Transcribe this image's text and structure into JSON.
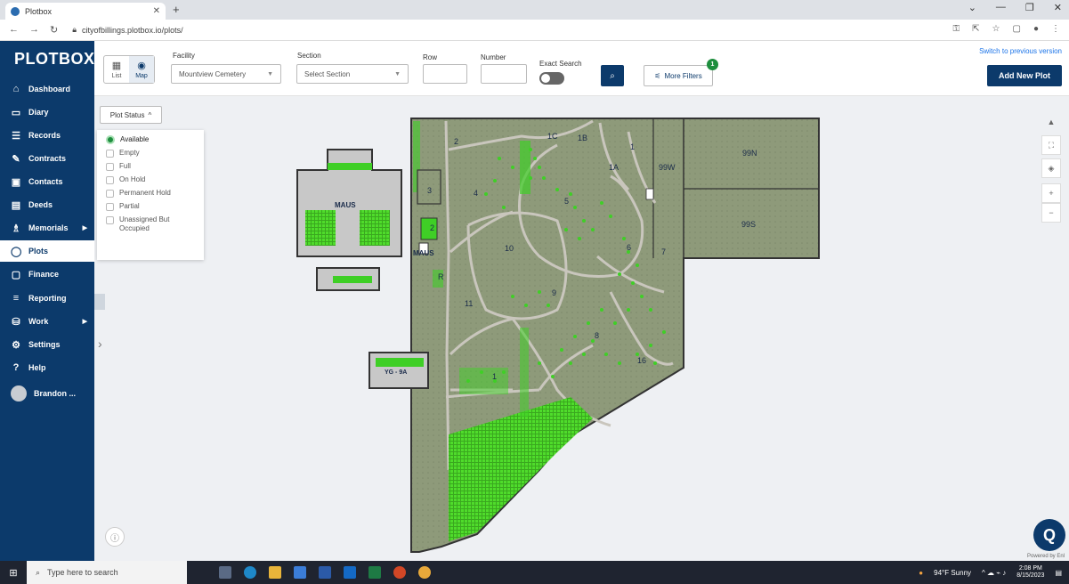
{
  "browser": {
    "tab_title": "Plotbox",
    "url": "cityofbillings.plotbox.io/plots/"
  },
  "sidebar": {
    "logo": "PLOTBOX",
    "items": [
      {
        "label": "Dashboard",
        "icon": "home-icon"
      },
      {
        "label": "Diary",
        "icon": "calendar-icon"
      },
      {
        "label": "Records",
        "icon": "records-icon"
      },
      {
        "label": "Contracts",
        "icon": "contract-icon"
      },
      {
        "label": "Contacts",
        "icon": "contacts-icon"
      },
      {
        "label": "Deeds",
        "icon": "deed-icon"
      },
      {
        "label": "Memorials",
        "icon": "memorial-icon"
      },
      {
        "label": "Plots",
        "icon": "plot-pin-icon"
      },
      {
        "label": "Finance",
        "icon": "finance-icon"
      },
      {
        "label": "Reporting",
        "icon": "reporting-icon"
      },
      {
        "label": "Work",
        "icon": "work-icon"
      },
      {
        "label": "Settings",
        "icon": "gear-icon"
      },
      {
        "label": "Help",
        "icon": "help-icon"
      }
    ],
    "user": "Brandon ..."
  },
  "topbar": {
    "view_list": "List",
    "view_map": "Map",
    "facility_label": "Facility",
    "facility_value": "Mountview Cemetery",
    "section_label": "Section",
    "section_placeholder": "Select Section",
    "row_label": "Row",
    "number_label": "Number",
    "exact_search_label": "Exact Search",
    "more_filters": "More Filters",
    "filter_count": "1",
    "switch_version": "Switch to previous version",
    "add_new_plot": "Add New Plot"
  },
  "plot_status": {
    "button": "Plot Status",
    "options": [
      "Available",
      "Empty",
      "Full",
      "On Hold",
      "Permanent Hold",
      "Partial",
      "Unassigned But Occupied"
    ],
    "selected": "Available"
  },
  "map": {
    "sections": [
      "2",
      "1C",
      "1B",
      "1",
      "1A",
      "99W",
      "99N",
      "99S",
      "3",
      "4",
      "5",
      "2",
      "10",
      "6",
      "7",
      "R",
      "9",
      "11",
      "8",
      "16",
      "1"
    ],
    "buildings": [
      "MAUS",
      "MAUS",
      "YG - 9A"
    ],
    "colors": {
      "plot_bg": "#8e9a7a",
      "available": "#3fcf26",
      "road": "#c9c6bd",
      "outline": "#333333"
    }
  },
  "chat": {
    "powered_by": "Powered by Enl"
  },
  "taskbar": {
    "search_placeholder": "Type here to search",
    "weather": "94°F Sunny",
    "time": "2:08 PM",
    "date": "8/15/2023"
  }
}
